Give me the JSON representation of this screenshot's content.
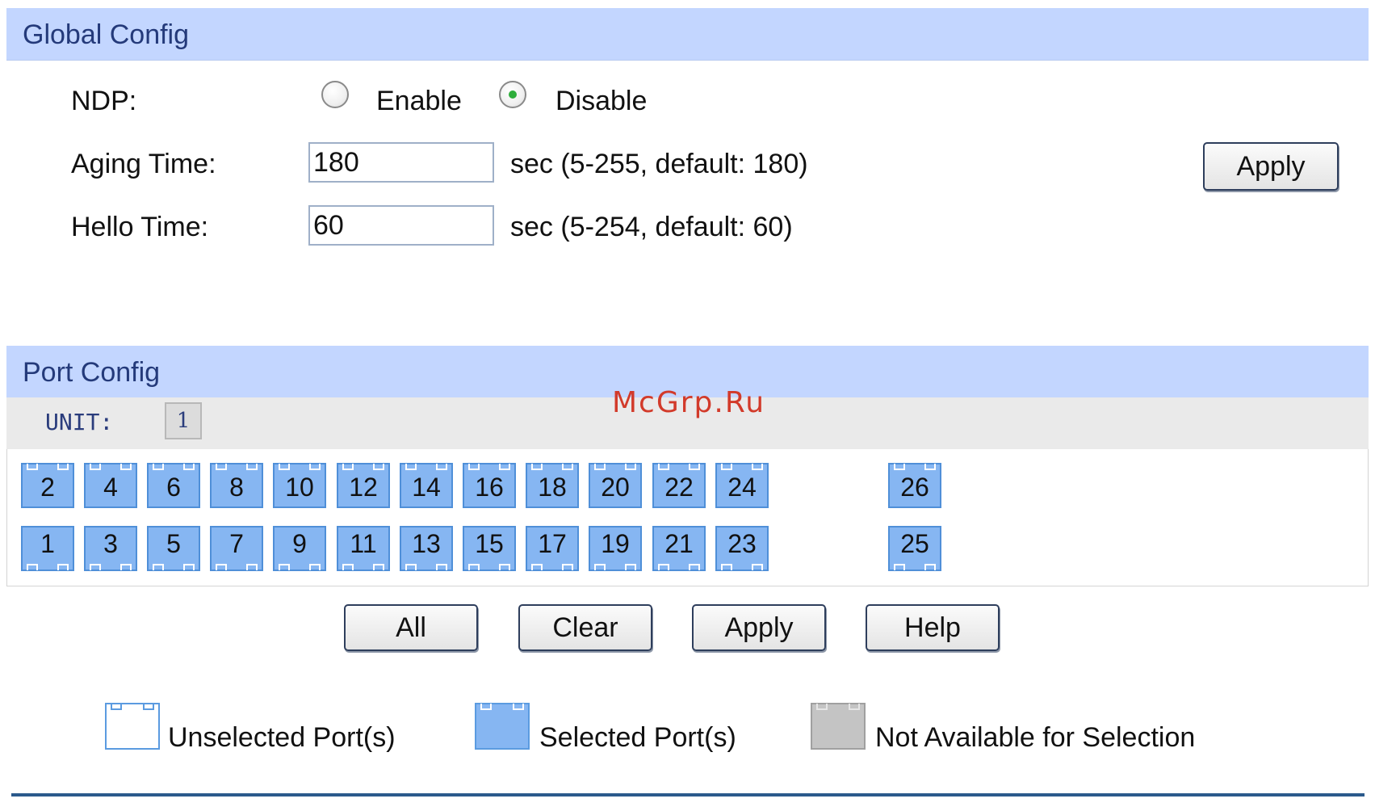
{
  "global_config": {
    "title": "Global Config",
    "ndp_label": "NDP:",
    "enable_label": "Enable",
    "disable_label": "Disable",
    "ndp_selected": "Disable",
    "aging_label": "Aging Time:",
    "aging_value": "180",
    "aging_hint": "sec (5-255, default: 180)",
    "hello_label": "Hello Time:",
    "hello_value": "60",
    "hello_hint": "sec (5-254, default: 60)",
    "apply_label": "Apply"
  },
  "port_config": {
    "title": "Port Config",
    "unit_label": "UNIT:",
    "unit_value": "1",
    "ports_top": [
      "2",
      "4",
      "6",
      "8",
      "10",
      "12",
      "14",
      "16",
      "18",
      "20",
      "22",
      "24",
      "26"
    ],
    "ports_bottom": [
      "1",
      "3",
      "5",
      "7",
      "9",
      "11",
      "13",
      "15",
      "17",
      "19",
      "21",
      "23",
      "25"
    ],
    "port_state": "selected",
    "buttons": {
      "all": "All",
      "clear": "Clear",
      "apply": "Apply",
      "help": "Help"
    }
  },
  "legend": {
    "unselected": "Unselected Port(s)",
    "selected": "Selected Port(s)",
    "not_available": "Not Available for Selection"
  },
  "watermark": "McGrp.Ru",
  "colors": {
    "section_bar": "#c3d6ff",
    "port_selected": "#86b6f2",
    "port_unavailable": "#c4c4c4",
    "radio_dot": "#2eae3b"
  }
}
